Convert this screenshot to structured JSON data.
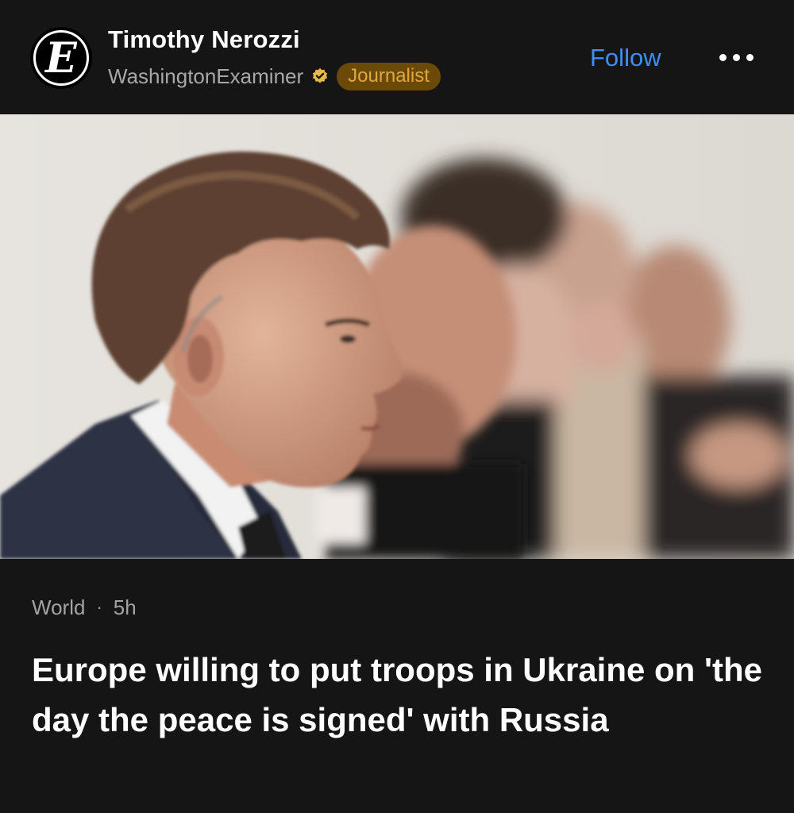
{
  "author": {
    "name": "Timothy Nerozzi",
    "source": "WashingtonExaminer",
    "badge": "Journalist",
    "avatar_letter": "E"
  },
  "actions": {
    "follow_label": "Follow",
    "more_icon": "more-horizontal-icon"
  },
  "article": {
    "category": "World",
    "separator": "·",
    "age": "5h",
    "headline": "Europe willing to put troops in Ukraine on 'the day the peace is signed' with Russia"
  },
  "colors": {
    "background": "#151515",
    "accent": "#3e8ff5",
    "badge_bg": "#6b4a08",
    "badge_text": "#e2a640",
    "verified": "#e8b84a"
  }
}
